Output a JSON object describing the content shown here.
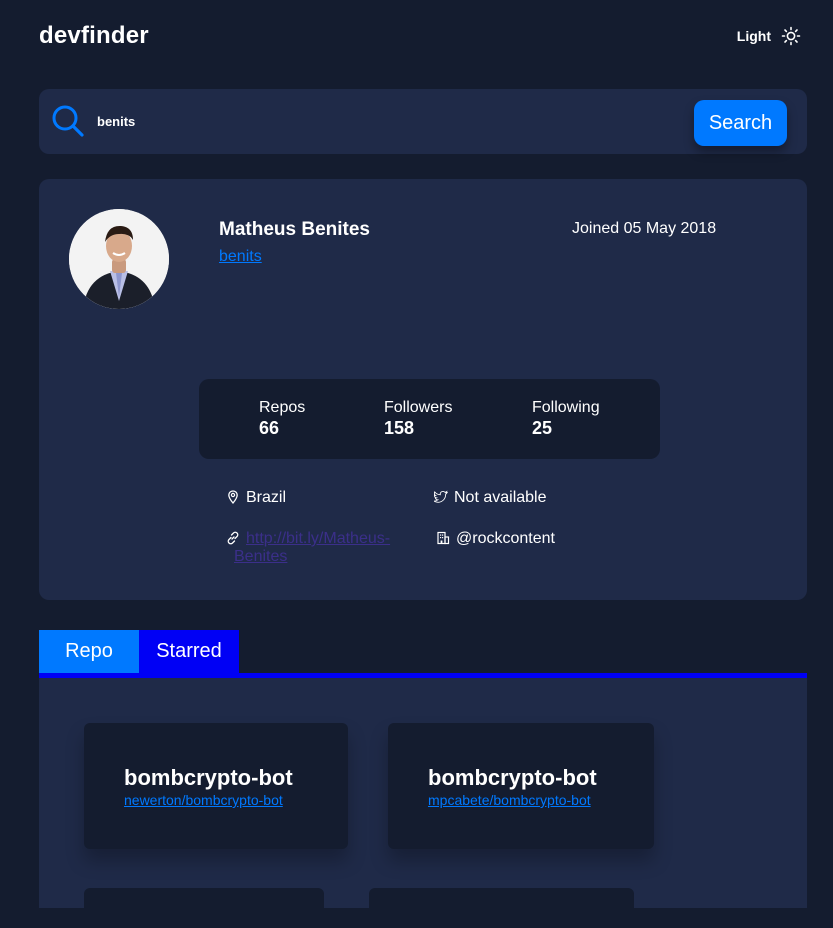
{
  "header": {
    "logo": "devfinder",
    "theme_label": "Light",
    "theme_icon": "sun-icon"
  },
  "search": {
    "icon": "search-icon",
    "value": "benits",
    "button_label": "Search"
  },
  "profile": {
    "name": "Matheus Benites",
    "login": "benits",
    "joined": "Joined 05 May 2018",
    "stats": {
      "repos_label": "Repos",
      "repos_value": "66",
      "followers_label": "Followers",
      "followers_value": "158",
      "following_label": "Following",
      "following_value": "25"
    },
    "location": "Brazil",
    "twitter": "Not available",
    "blog": "http://bit.ly/Matheus-Benites",
    "company": "@rockcontent"
  },
  "tabs": [
    {
      "label": "Repo",
      "active": true
    },
    {
      "label": "Starred",
      "active": false
    }
  ],
  "repos": [
    {
      "name": "bombcrypto-bot",
      "full_name": "newerton/bombcrypto-bot"
    },
    {
      "name": "bombcrypto-bot",
      "full_name": "mpcabete/bombcrypto-bot"
    }
  ],
  "colors": {
    "background": "#141c2f",
    "card": "#1f2a48",
    "accent": "#0079ff",
    "tab_active": "#0000f5"
  }
}
